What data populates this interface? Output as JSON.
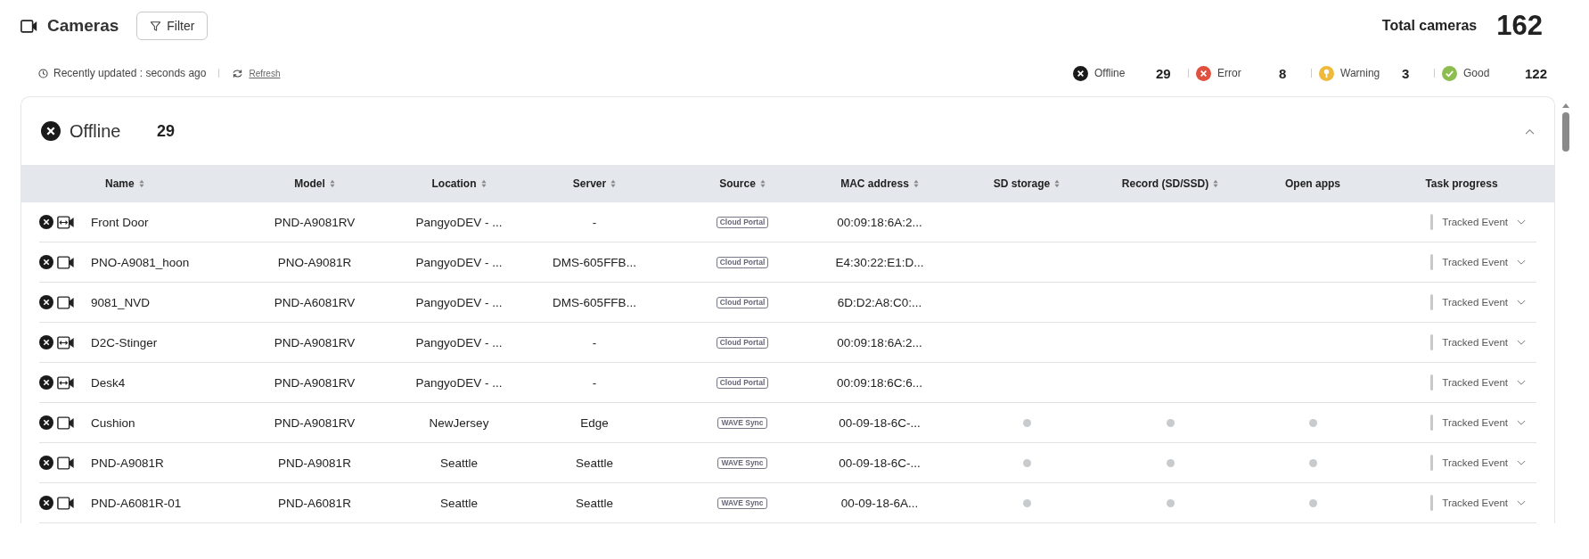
{
  "page": {
    "title": "Cameras",
    "filter_button": "Filter",
    "total_label": "Total cameras",
    "total_count": "162"
  },
  "update_bar": {
    "text": "Recently updated : seconds ago",
    "refresh": "Refresh"
  },
  "summary": [
    {
      "kind": "offline",
      "label": "Offline",
      "count": "29"
    },
    {
      "kind": "error",
      "label": "Error",
      "count": "8"
    },
    {
      "kind": "warning",
      "label": "Warning",
      "count": "3"
    },
    {
      "kind": "good",
      "label": "Good",
      "count": "122"
    }
  ],
  "group": {
    "kind": "offline",
    "label": "Offline",
    "count": "29",
    "expanded": true
  },
  "table": {
    "columns": [
      {
        "label": "Name",
        "sortable": true
      },
      {
        "label": "Model",
        "sortable": true
      },
      {
        "label": "Location",
        "sortable": true
      },
      {
        "label": "Server",
        "sortable": true
      },
      {
        "label": "Source",
        "sortable": true
      },
      {
        "label": "MAC address",
        "sortable": true
      },
      {
        "label": "SD storage",
        "sortable": true
      },
      {
        "label": "Record (SD/SSD)",
        "sortable": true
      },
      {
        "label": "Open apps",
        "sortable": false
      },
      {
        "label": "Task progress",
        "sortable": false
      }
    ],
    "rows": [
      {
        "kind": "wide",
        "name": "Front Door",
        "model": "PND-A9081RV",
        "location": "PangyoDEV - ...",
        "server": "-",
        "source": "Cloud Portal",
        "mac": "00:09:18:6A:2...",
        "sd_dot": false,
        "record_dot": false,
        "apps_dot": false,
        "task": "Tracked Event"
      },
      {
        "kind": "standard",
        "name": "PNO-A9081_hoon",
        "model": "PNO-A9081R",
        "location": "PangyoDEV - ...",
        "server": "DMS-605FFB...",
        "source": "Cloud Portal",
        "mac": "E4:30:22:E1:D...",
        "sd_dot": false,
        "record_dot": false,
        "apps_dot": false,
        "task": "Tracked Event"
      },
      {
        "kind": "standard",
        "name": "9081_NVD",
        "model": "PND-A6081RV",
        "location": "PangyoDEV - ...",
        "server": "DMS-605FFB...",
        "source": "Cloud Portal",
        "mac": "6D:D2:A8:C0:...",
        "sd_dot": false,
        "record_dot": false,
        "apps_dot": false,
        "task": "Tracked Event"
      },
      {
        "kind": "wide",
        "name": "D2C-Stinger",
        "model": "PND-A9081RV",
        "location": "PangyoDEV - ...",
        "server": "-",
        "source": "Cloud Portal",
        "mac": "00:09:18:6A:2...",
        "sd_dot": false,
        "record_dot": false,
        "apps_dot": false,
        "task": "Tracked Event"
      },
      {
        "kind": "wide",
        "name": "Desk4",
        "model": "PND-A9081RV",
        "location": "PangyoDEV - ...",
        "server": "-",
        "source": "Cloud Portal",
        "mac": "00:09:18:6C:6...",
        "sd_dot": false,
        "record_dot": false,
        "apps_dot": false,
        "task": "Tracked Event"
      },
      {
        "kind": "standard",
        "name": "Cushion",
        "model": "PND-A9081RV",
        "location": "NewJersey",
        "server": "Edge",
        "source": "WAVE Sync",
        "mac": "00-09-18-6C-...",
        "sd_dot": true,
        "record_dot": true,
        "apps_dot": true,
        "task": "Tracked Event"
      },
      {
        "kind": "standard",
        "name": "PND-A9081R",
        "model": "PND-A9081R",
        "location": "Seattle",
        "server": "Seattle",
        "source": "WAVE Sync",
        "mac": "00-09-18-6C-...",
        "sd_dot": true,
        "record_dot": true,
        "apps_dot": true,
        "task": "Tracked Event"
      },
      {
        "kind": "standard",
        "name": "PND-A6081R-01",
        "model": "PND-A6081R",
        "location": "Seattle",
        "server": "Seattle",
        "source": "WAVE Sync",
        "mac": "00-09-18-6A...",
        "sd_dot": true,
        "record_dot": true,
        "apps_dot": true,
        "task": "Tracked Event"
      }
    ]
  }
}
